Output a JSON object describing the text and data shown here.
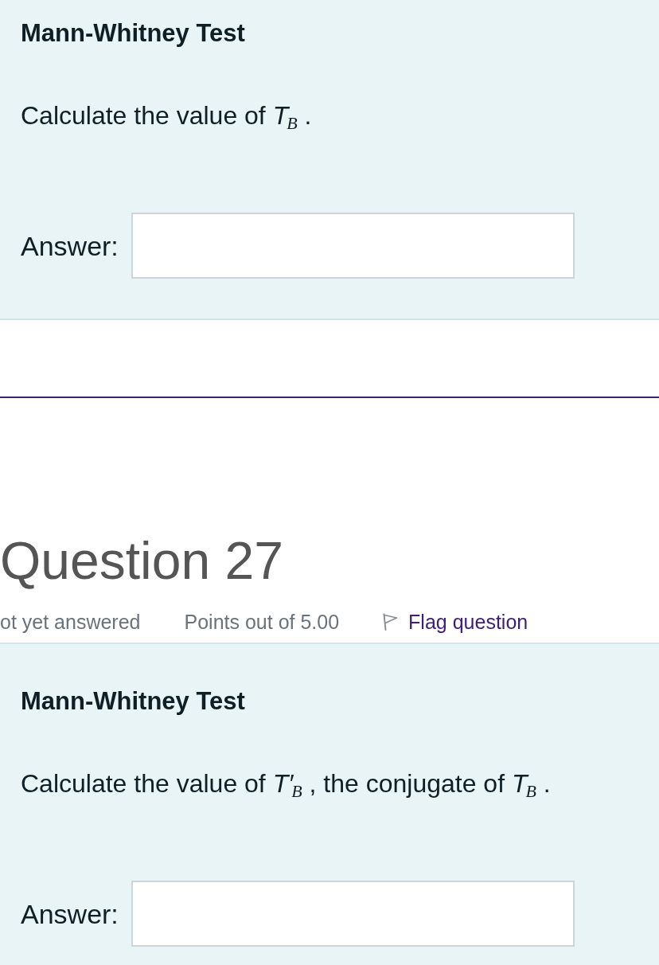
{
  "previous_question": {
    "title": "Mann-Whitney Test",
    "prompt": "Calculate the value of *T*$_{B}$ .",
    "answer_label": "Answer:"
  },
  "question": {
    "heading": "Question 27",
    "status": "ot yet answered",
    "points": "Points out of 5.00",
    "flag_link": "Flag question",
    "title": "Mann-Whitney Test",
    "prompt": "Calculate the value of *T′*$_{B}$ , the conjugate of *T*$_{B}$ .",
    "answer_label": "Answer:"
  }
}
